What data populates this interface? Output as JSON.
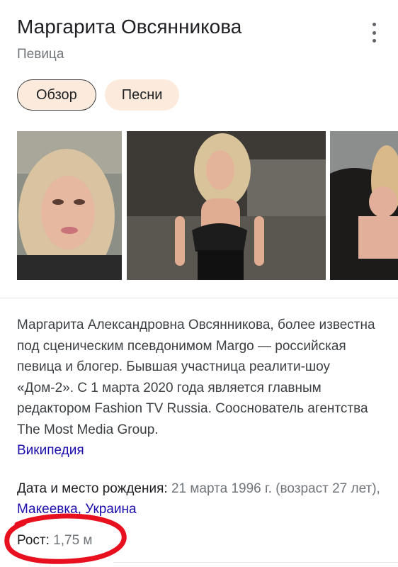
{
  "header": {
    "title": "Маргарита Овсянникова",
    "subtitle": "Певица"
  },
  "tabs": [
    {
      "label": "Обзор",
      "active": true
    },
    {
      "label": "Песни",
      "active": false
    }
  ],
  "description": {
    "text": "Маргарита Александровна Овсянникова, более известна под сценическим псевдонимом Margo — российская певица и блогер. Бывшая участница реалити-шоу «Дом-2». С 1 марта 2020 года является главным редактором Fashion TV Russia. Сооснователь агентства The Most Media Group.",
    "source": "Википедия"
  },
  "facts": {
    "birth": {
      "label": "Дата и место рождения:",
      "value": "21 марта 1996 г. (возраст 27 лет),",
      "place_city": "Макеевка",
      "place_country": "Украина"
    },
    "height": {
      "label": "Рост:",
      "value": "1,75 м"
    }
  },
  "colors": {
    "chip_bg": "#fcebdd",
    "link": "#1a0dab",
    "annotation": "#e8101e"
  }
}
